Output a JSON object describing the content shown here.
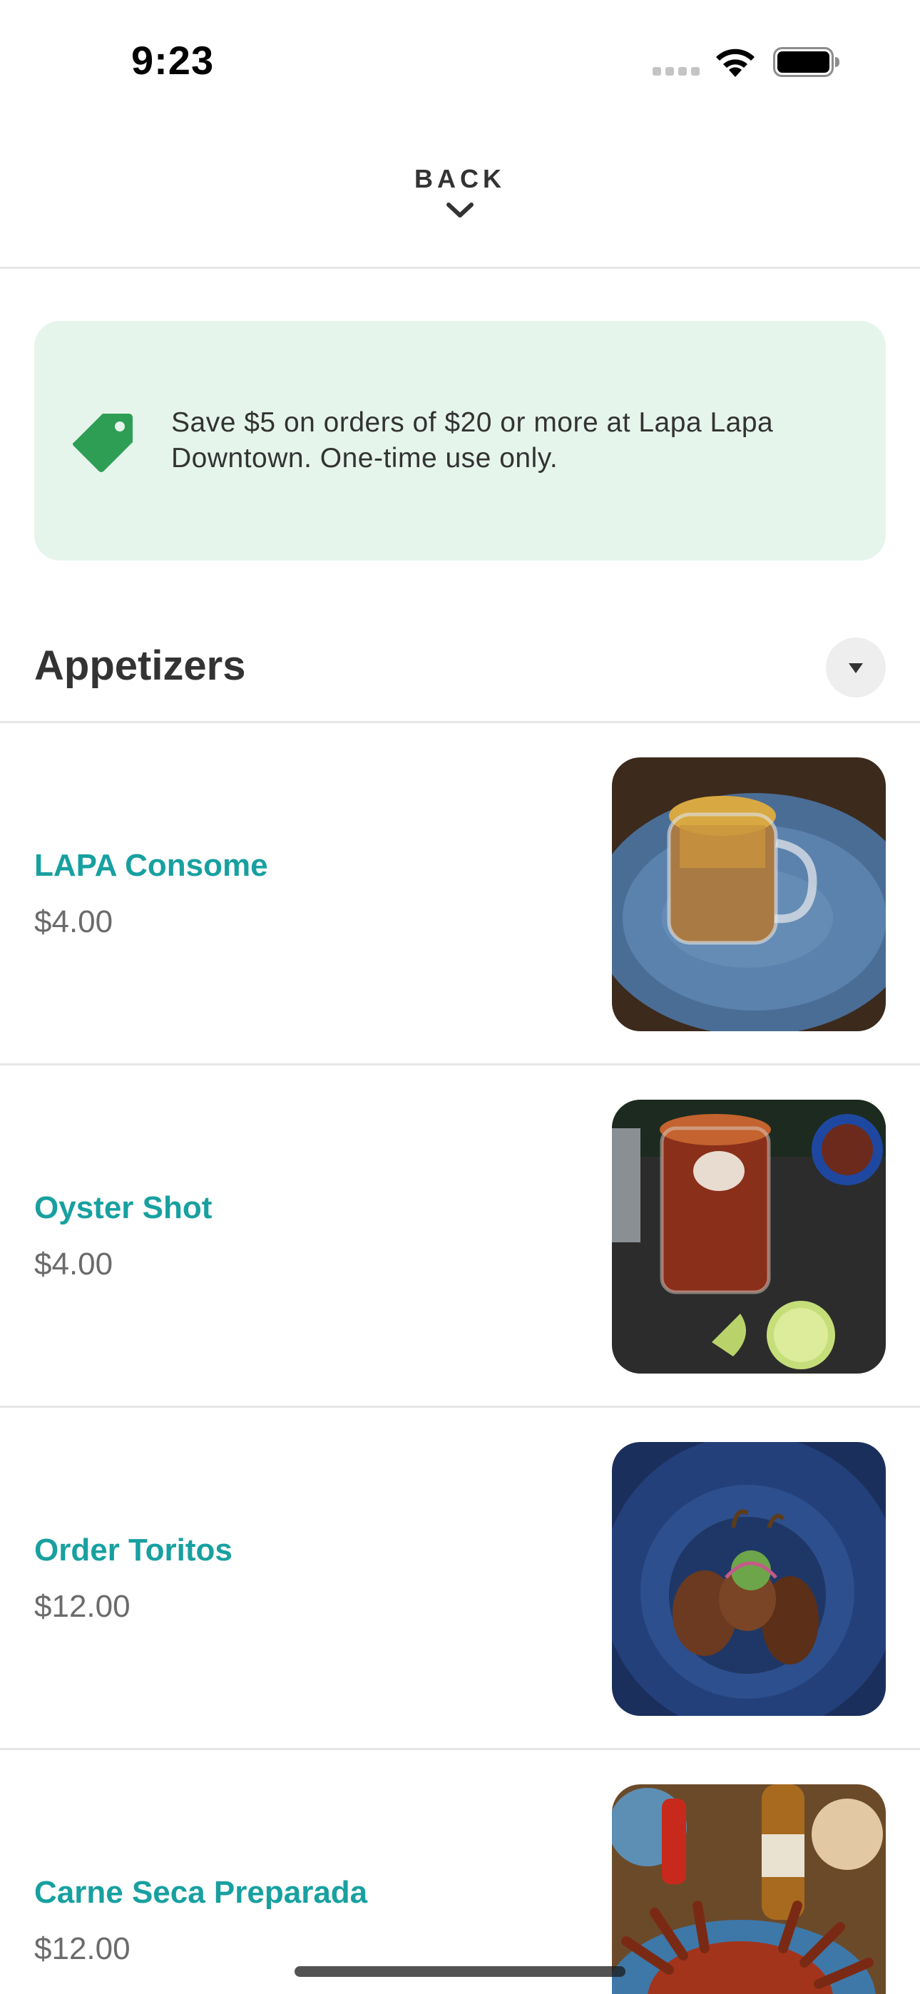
{
  "status_bar": {
    "time": "9:23"
  },
  "header": {
    "back_label": "BACK"
  },
  "promo": {
    "text": "Save $5 on orders of $20 or more at Lapa Lapa Downtown. One-time use only.",
    "icon": "tag-icon",
    "accent_color": "#2e9e55",
    "background_color": "#e6f5ec"
  },
  "section": {
    "title": "Appetizers"
  },
  "menu_items": [
    {
      "name": "LAPA Consome",
      "price": "$4.00",
      "photo": "consome-photo"
    },
    {
      "name": "Oyster Shot",
      "price": "$4.00",
      "photo": "oyster-shot-photo"
    },
    {
      "name": "Order Toritos",
      "price": "$12.00",
      "photo": "toritos-photo"
    },
    {
      "name": "Carne Seca Preparada",
      "price": "$12.00",
      "photo": "carne-seca-photo"
    }
  ],
  "colors": {
    "item_name": "#18a0a0",
    "price": "#6b6b6b",
    "divider": "#e6e6e6"
  }
}
